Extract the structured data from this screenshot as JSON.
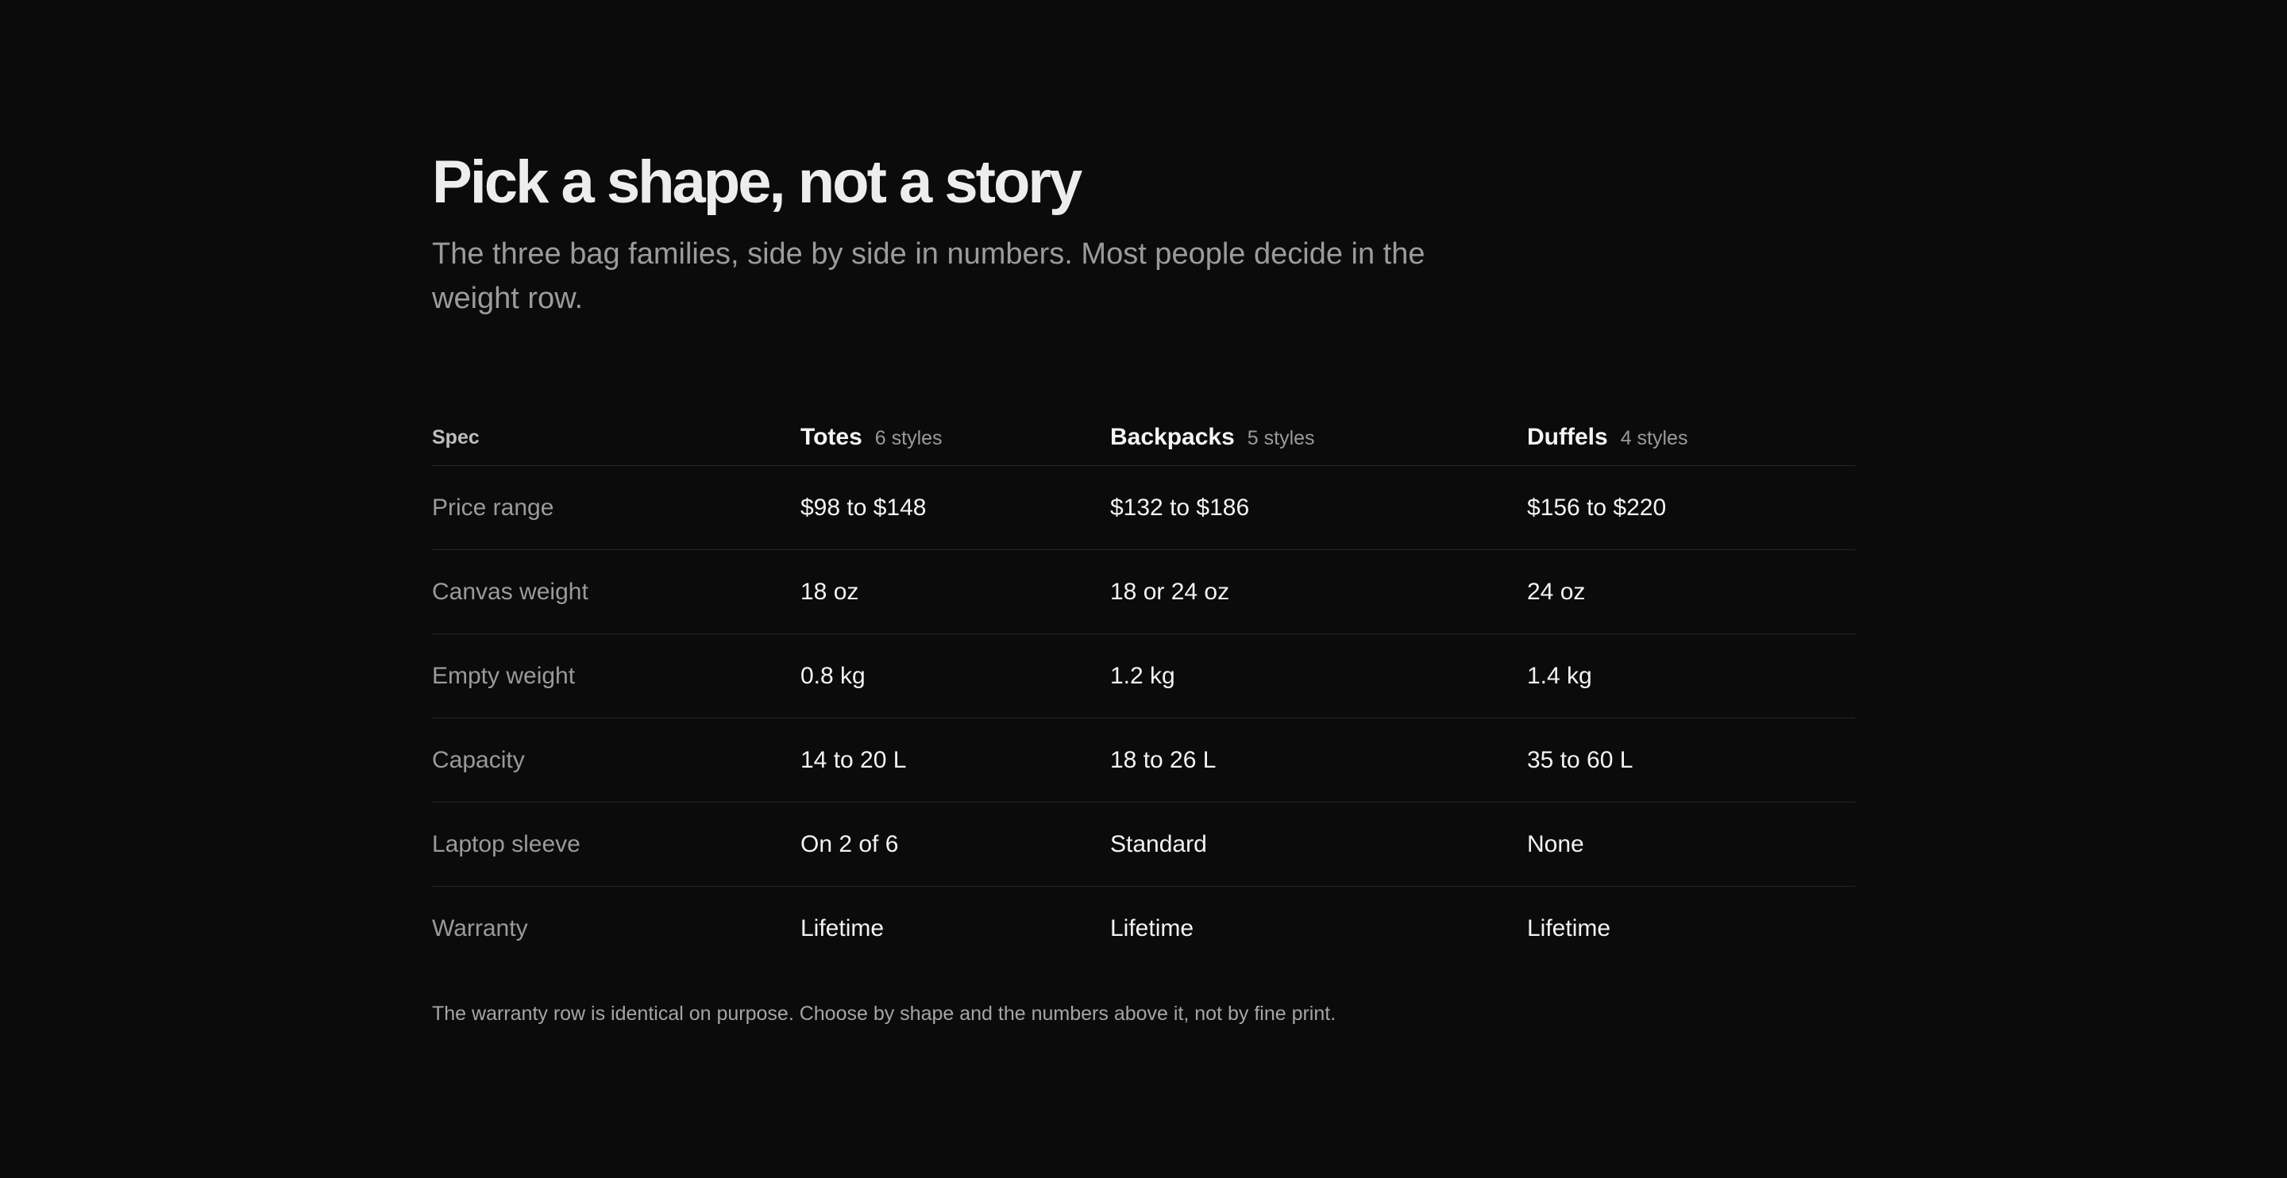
{
  "header": {
    "title": "Pick a shape, not a story",
    "subtitle": "The three bag families, side by side in numbers. Most people decide in the weight row."
  },
  "table": {
    "spec_label": "Spec",
    "columns": [
      {
        "name": "Totes",
        "count": "6 styles"
      },
      {
        "name": "Backpacks",
        "count": "5 styles"
      },
      {
        "name": "Duffels",
        "count": "4 styles"
      }
    ],
    "rows": [
      {
        "label": "Price range",
        "values": [
          "$98 to $148",
          "$132 to $186",
          "$156 to $220"
        ]
      },
      {
        "label": "Canvas weight",
        "values": [
          "18 oz",
          "18 or 24 oz",
          "24 oz"
        ]
      },
      {
        "label": "Empty weight",
        "values": [
          "0.8 kg",
          "1.2 kg",
          "1.4 kg"
        ]
      },
      {
        "label": "Capacity",
        "values": [
          "14 to 20 L",
          "18 to 26 L",
          "35 to 60 L"
        ]
      },
      {
        "label": "Laptop sleeve",
        "values": [
          "On 2 of 6",
          "Standard",
          "None"
        ]
      },
      {
        "label": "Warranty",
        "values": [
          "Lifetime",
          "Lifetime",
          "Lifetime"
        ]
      }
    ]
  },
  "footnote": "The warranty row is identical on purpose. Choose by shape and the numbers above it, not by fine print."
}
